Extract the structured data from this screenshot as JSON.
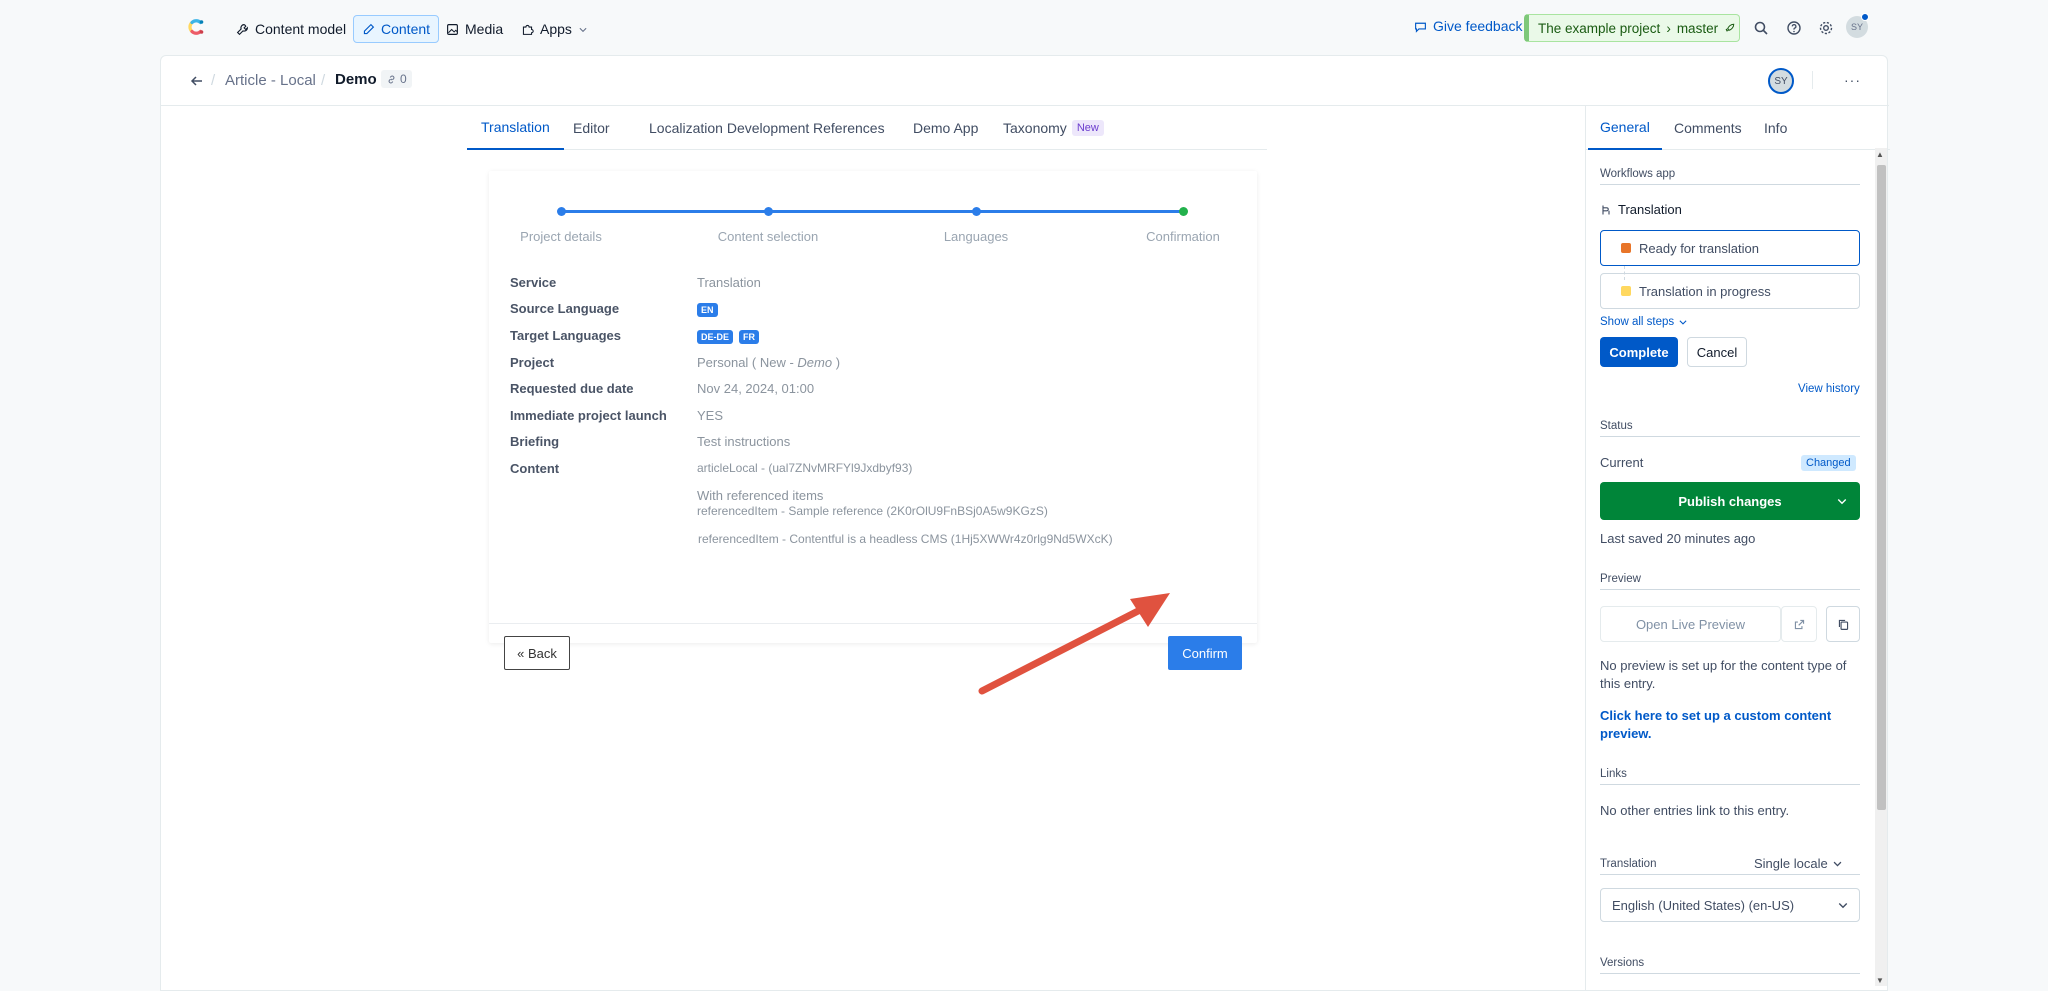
{
  "topnav": {
    "content_model": "Content model",
    "content": "Content",
    "media": "Media",
    "apps": "Apps",
    "feedback": "Give feedback",
    "env_project": "The example project",
    "env_branch": "master",
    "user_initials": "SY"
  },
  "entry": {
    "content_type": "Article - Local",
    "title": "Demo",
    "link_count": "0",
    "avatar": "SY"
  },
  "tabs": [
    "Translation",
    "Editor",
    "Localization Development",
    "References",
    "Demo App",
    "Taxonomy"
  ],
  "tab_new_badge": "New",
  "wizard": {
    "steps": [
      "Project details",
      "Content selection",
      "Languages",
      "Confirmation"
    ],
    "labels": {
      "service": "Service",
      "source": "Source Language",
      "target": "Target Languages",
      "project": "Project",
      "due": "Requested due date",
      "launch": "Immediate project launch",
      "briefing": "Briefing",
      "content": "Content"
    },
    "values": {
      "service": "Translation",
      "source_badge": "EN",
      "target_badge_1": "DE-DE",
      "target_badge_2": "FR",
      "project_pre": "Personal ( New - ",
      "project_em": "Demo",
      "project_post": " )",
      "due": "Nov 24, 2024, 01:00",
      "launch": "YES",
      "briefing": "Test instructions",
      "content_main": "articleLocal - (ual7ZNvMRFYl9Jxdbyf93)",
      "with_ref": "With referenced items",
      "ref1": "referencedItem - Sample reference (2K0rOlU9FnBSj0A5w9KGzS)",
      "ref2": "referencedItem - Contentful is a headless CMS (1Hj5XWWr4z0rlg9Nd5WXcK)"
    },
    "back_label": "« Back",
    "confirm_label": "Confirm"
  },
  "sidebar": {
    "tabs": [
      "General",
      "Comments",
      "Info"
    ],
    "workflows_header": "Workflows app",
    "workflow_name": "Translation",
    "step1": "Ready for translation",
    "step2": "Translation in progress",
    "show_all": "Show all steps",
    "complete": "Complete",
    "cancel": "Cancel",
    "view_history": "View history",
    "status_header": "Status",
    "current": "Current",
    "changed": "Changed",
    "publish": "Publish changes",
    "last_saved": "Last saved 20 minutes ago",
    "preview_header": "Preview",
    "open_live_preview": "Open Live Preview",
    "no_preview": "No preview is set up for the content type of this entry.",
    "setup_preview": "Click here to set up a custom content preview.",
    "links_header": "Links",
    "no_links": "No other entries link to this entry.",
    "translation_header": "Translation",
    "single_locale": "Single locale",
    "locale": "English (United States) (en-US)",
    "versions_header": "Versions"
  },
  "colors": {
    "accent": "#0059c8",
    "publish": "#008539",
    "step_blue": "#2b7de9",
    "step_green": "#22b14c",
    "arrow": "#e0523f"
  }
}
